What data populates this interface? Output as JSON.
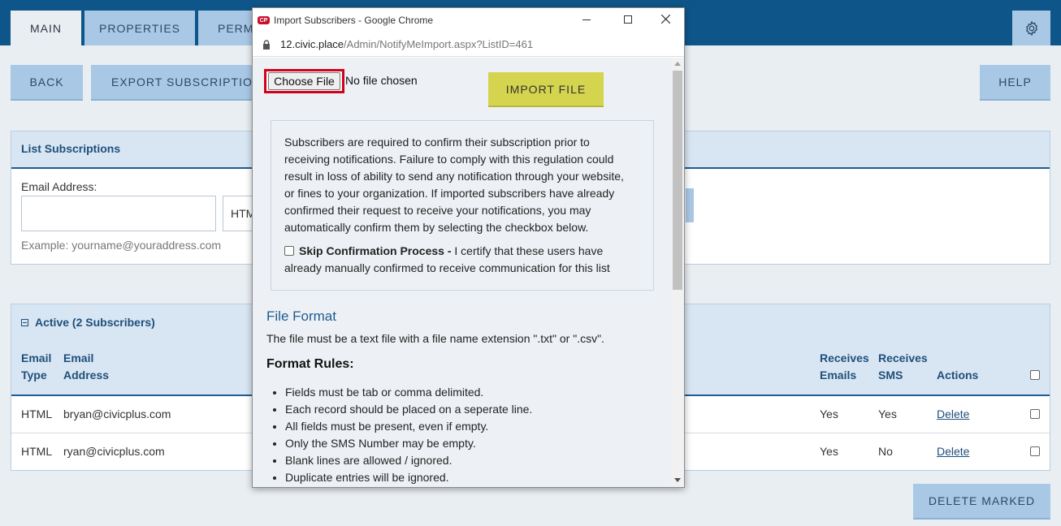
{
  "nav": {
    "tabs": [
      "MAIN",
      "PROPERTIES",
      "PERMI"
    ],
    "settings_icon": "gear-icon"
  },
  "toolbar": {
    "back": "BACK",
    "export": "EXPORT SUBSCRIPTIONS",
    "help": "HELP"
  },
  "list_subscriptions": {
    "title": "List Subscriptions",
    "email_label": "Email Address:",
    "email_value": "",
    "type_partial": "HTM",
    "example": "Example: yourname@youraddress.com"
  },
  "active": {
    "title": "Active (2 Subscribers)",
    "headers": {
      "email_type": [
        "Email",
        "Type"
      ],
      "email_address": [
        "Email",
        "Address"
      ],
      "receives_emails": [
        "Receives",
        "Emails"
      ],
      "receives_sms": [
        "Receives",
        "SMS"
      ],
      "actions": "Actions"
    },
    "rows": [
      {
        "type": "HTML",
        "email": "bryan@civicplus.com",
        "emails": "Yes",
        "sms": "Yes",
        "action": "Delete"
      },
      {
        "type": "HTML",
        "email": "ryan@civicplus.com",
        "emails": "Yes",
        "sms": "No",
        "action": "Delete"
      }
    ],
    "delete_marked": "DELETE MARKED"
  },
  "popup": {
    "window_title": "Import Subscribers - Google Chrome",
    "url_host": "12.civic.place",
    "url_path": "/Admin/NotifyMeImport.aspx?ListID=461",
    "choose_file": "Choose File",
    "no_file": "No file chosen",
    "import_button": "IMPORT FILE",
    "notice_lines": [
      "Subscribers are required to confirm their subscription prior to",
      "receiving notifications. Failure to comply with this regulation could",
      "result in loss of ability to send any notification through your website,",
      "or fines to your organization. If imported subscribers have already",
      "confirmed their request to receive your notifications, you may",
      "automatically confirm them by selecting the checkbox below."
    ],
    "skip_label": "Skip Confirmation Process -",
    "skip_text_1": " I certify that these users have",
    "skip_text_2": "already manually confirmed to receive communication for this list",
    "file_format_title": "File Format",
    "file_format_text": "The file must be a text file with a file name extension \".txt\" or \".csv\".",
    "format_rules_title": "Format Rules:",
    "rules": [
      "Fields must be tab or comma delimited.",
      "Each record should be placed on a seperate line.",
      "All fields must be present, even if empty.",
      "Only the SMS Number may be empty.",
      "Blank lines are allowed / ignored.",
      "Duplicate entries will be ignored."
    ]
  },
  "colors": {
    "nav": "#0e5689",
    "button": "#a9c8e6",
    "import_button": "#d4d44e",
    "highlight": "#d0021b"
  }
}
